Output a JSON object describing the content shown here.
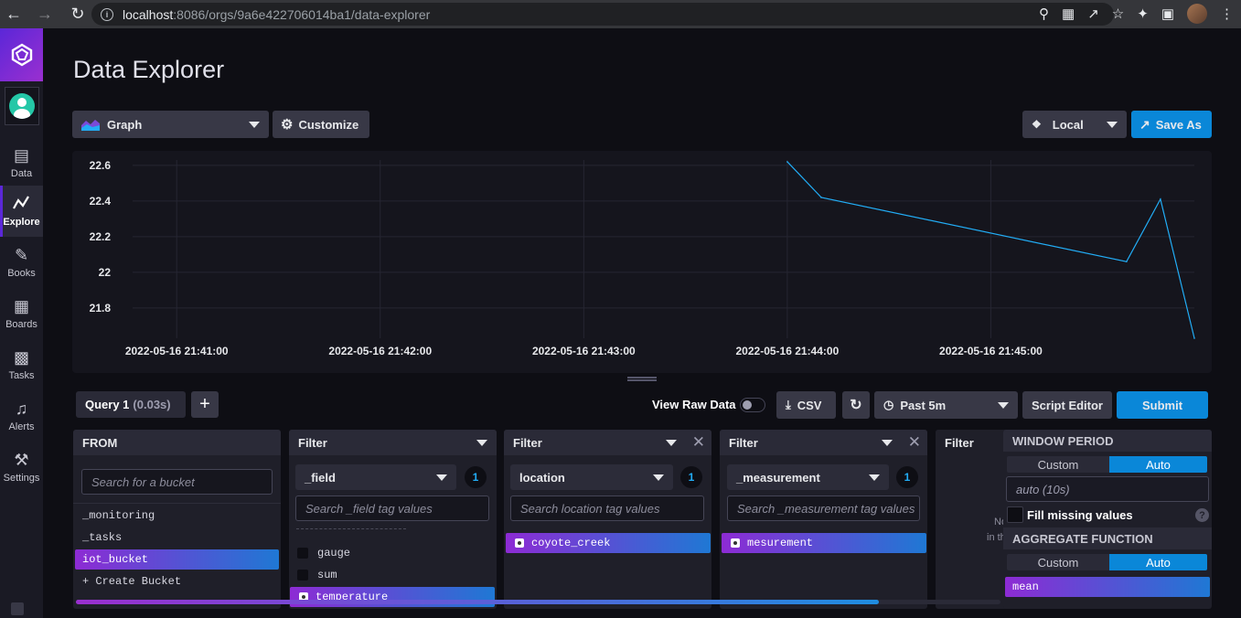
{
  "browser": {
    "url_host": "localhost",
    "url_path": ":8086/orgs/9a6e422706014ba1/data-explorer"
  },
  "sidebar": {
    "items": [
      {
        "label": "Data",
        "icon": "database-icon"
      },
      {
        "label": "Explore",
        "icon": "explore-graph-icon",
        "active": true
      },
      {
        "label": "Books",
        "icon": "notebook-icon"
      },
      {
        "label": "Boards",
        "icon": "dashboard-icon"
      },
      {
        "label": "Tasks",
        "icon": "calendar-icon"
      },
      {
        "label": "Alerts",
        "icon": "bell-icon"
      },
      {
        "label": "Settings",
        "icon": "wrench-icon"
      }
    ]
  },
  "header": {
    "title": "Data Explorer",
    "viz_type": "Graph",
    "customize_label": "Customize",
    "timezone": "Local",
    "save_as_label": "Save As"
  },
  "chart_data": {
    "type": "line",
    "x": [
      "2022-05-16 21:44:00",
      "2022-05-16 21:44:10",
      "2022-05-16 21:45:40",
      "2022-05-16 21:45:50",
      "2022-05-16 21:46:00"
    ],
    "series": [
      {
        "values": [
          22.62,
          22.42,
          22.06,
          22.41,
          21.63
        ]
      }
    ],
    "y_ticks": [
      "22.6",
      "22.4",
      "22.2",
      "22",
      "21.8"
    ],
    "x_ticks": [
      "2022-05-16 21:41:00",
      "2022-05-16 21:42:00",
      "2022-05-16 21:43:00",
      "2022-05-16 21:44:00",
      "2022-05-16 21:45:00"
    ],
    "ylim": [
      21.63,
      22.63
    ],
    "xlim": [
      "2022-05-16 21:40:47",
      "2022-05-16 21:46:00"
    ],
    "line_color": "#22adf6",
    "grid": true
  },
  "query_bar": {
    "tab_label": "Query 1",
    "tab_time": "(0.03s)",
    "add_label": "+",
    "raw_data_label": "View Raw Data",
    "csv_label": "CSV",
    "time_range": "Past 5m",
    "script_editor_label": "Script Editor",
    "submit_label": "Submit"
  },
  "from_card": {
    "title": "FROM",
    "search_placeholder": "Search for a bucket",
    "buckets": [
      "_monitoring",
      "_tasks",
      "iot_bucket"
    ],
    "selected": "iot_bucket",
    "create_label": "+ Create Bucket"
  },
  "filter1": {
    "title": "Filter",
    "key": "_field",
    "count": "1",
    "search_placeholder": "Search _field tag values",
    "values": [
      "gauge",
      "sum"
    ],
    "selected": "temperature"
  },
  "filter2": {
    "title": "Filter",
    "key": "location",
    "count": "1",
    "search_placeholder": "Search location tag values",
    "selected": "coyote_creek"
  },
  "filter3": {
    "title": "Filter",
    "key": "_measurement",
    "count": "1",
    "search_placeholder": "Search _measurement tag values",
    "selected": "mesurement"
  },
  "filter4": {
    "title": "Filter",
    "clipped_text1": "No",
    "clipped_text2": "in th"
  },
  "window": {
    "title": "WINDOW PERIOD",
    "custom_label": "Custom",
    "auto_label": "Auto",
    "period_value": "auto (10s)",
    "fill_missing_label": "Fill missing values",
    "aggregate_title": "AGGREGATE FUNCTION",
    "selected_fn": "mean"
  }
}
